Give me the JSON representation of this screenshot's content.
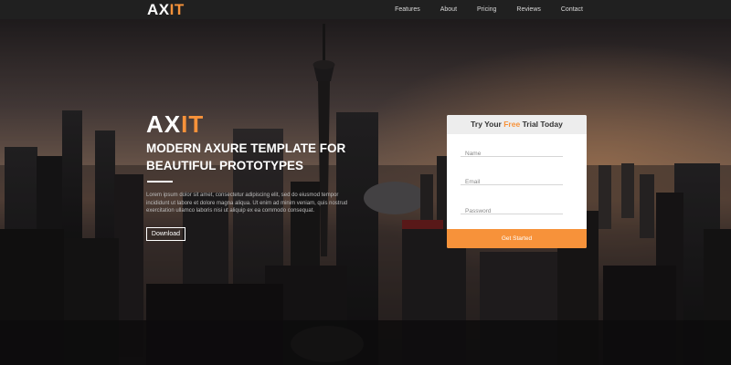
{
  "navbar": {
    "logo_a": "AX",
    "logo_b": "IT",
    "links": [
      "Features",
      "About",
      "Pricing",
      "Reviews",
      "Contact"
    ]
  },
  "hero": {
    "logo_a": "AX",
    "logo_b": "IT",
    "headline": "MODERN AXURE TEMPLATE FOR BEAUTIFUL PROTOTYPES",
    "body": "Lorem ipsum dolor sit amet, consectetur adipiscing elit, sed do eiusmod tempor incididunt ut labore et dolore magna aliqua. Ut enim ad minim veniam, quis nostrud exercitation ullamco laboris nisi ut aliquip ex ea commodo consequat.",
    "download_label": "Download"
  },
  "trial_form": {
    "title_pre": "Try Your ",
    "title_accent": "Free",
    "title_post": " Trial Today",
    "name_placeholder": "Name",
    "email_placeholder": "Email",
    "password_placeholder": "Password",
    "submit_label": "Get Started"
  },
  "colors": {
    "accent": "#f7923a",
    "navbar_bg": "#202020",
    "card_header_bg": "#ededed"
  },
  "background": "city-skyline-photo-at-dusk"
}
